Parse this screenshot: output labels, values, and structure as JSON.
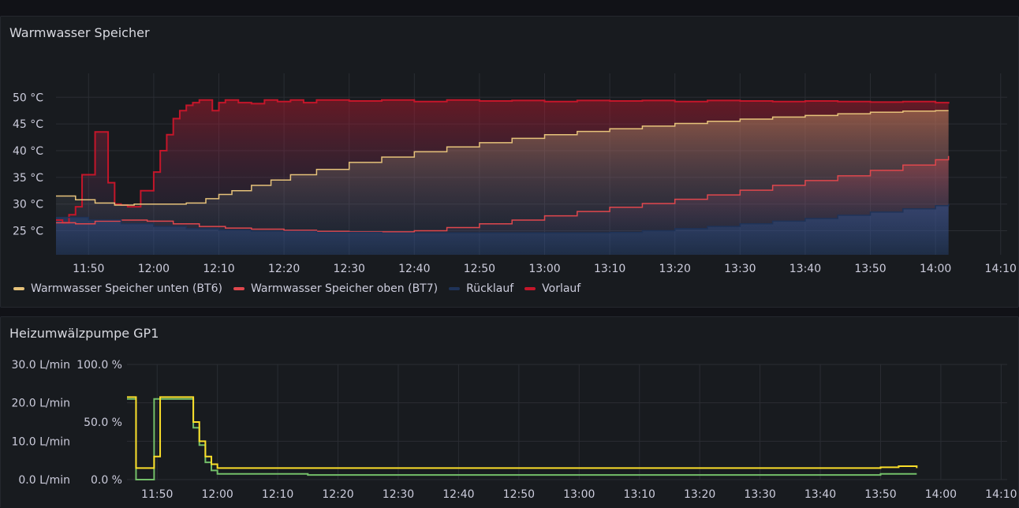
{
  "panels": {
    "speicher_title": "Warmwasser Speicher",
    "pumpe_title": "Heizumwälzpumpe GP1"
  },
  "colors": {
    "bt6": "#e6c27a",
    "bt7": "#e0474d",
    "ruecklauf": "#1f3358",
    "vorlauf": "#c4162a",
    "flow": "#fade2a",
    "percent": "#73bf69",
    "grid": "#2a2d33",
    "text": "#ccccdc"
  },
  "chart_data": [
    {
      "type": "line",
      "title": "Warmwasser Speicher",
      "x_ticks": [
        "11:50",
        "12:00",
        "12:10",
        "12:20",
        "12:30",
        "12:40",
        "12:50",
        "13:00",
        "13:10",
        "13:20",
        "13:30",
        "13:40",
        "13:50",
        "14:00",
        "14:10"
      ],
      "xlim": [
        "11:45",
        "14:11"
      ],
      "y_ticks": [
        "25 °C",
        "30 °C",
        "35 °C",
        "40 °C",
        "45 °C",
        "50 °C"
      ],
      "ylim": [
        20.5,
        53
      ],
      "x_unit": "minutes after 11:45 (sample times)",
      "legend_position": "bottom-left",
      "grid": true,
      "series": [
        {
          "name": "Warmwasser Speicher unten (BT6)",
          "color_key": "bt6",
          "points": [
            [
              0,
              31.5
            ],
            [
              3,
              30.8
            ],
            [
              6,
              30.2
            ],
            [
              9,
              29.8
            ],
            [
              12,
              30.0
            ],
            [
              15,
              30.0
            ],
            [
              20,
              30.2
            ],
            [
              23,
              31.0
            ],
            [
              25,
              31.8
            ],
            [
              27,
              32.5
            ],
            [
              30,
              33.5
            ],
            [
              33,
              34.5
            ],
            [
              36,
              35.5
            ],
            [
              40,
              36.5
            ],
            [
              45,
              37.8
            ],
            [
              50,
              38.8
            ],
            [
              55,
              39.8
            ],
            [
              60,
              40.7
            ],
            [
              65,
              41.5
            ],
            [
              70,
              42.3
            ],
            [
              75,
              43.0
            ],
            [
              80,
              43.6
            ],
            [
              85,
              44.1
            ],
            [
              90,
              44.6
            ],
            [
              95,
              45.1
            ],
            [
              100,
              45.5
            ],
            [
              105,
              45.9
            ],
            [
              110,
              46.3
            ],
            [
              115,
              46.6
            ],
            [
              120,
              46.9
            ],
            [
              125,
              47.2
            ],
            [
              130,
              47.4
            ],
            [
              135,
              47.5
            ],
            [
              137,
              47.5
            ]
          ]
        },
        {
          "name": "Warmwasser Speicher oben (BT7)",
          "color_key": "bt7",
          "points": [
            [
              0,
              26.5
            ],
            [
              3,
              26.3
            ],
            [
              6,
              26.8
            ],
            [
              10,
              27.0
            ],
            [
              14,
              26.8
            ],
            [
              18,
              26.3
            ],
            [
              22,
              25.8
            ],
            [
              26,
              25.5
            ],
            [
              30,
              25.3
            ],
            [
              35,
              25.1
            ],
            [
              40,
              24.9
            ],
            [
              45,
              24.8
            ],
            [
              50,
              24.8
            ],
            [
              55,
              25.0
            ],
            [
              60,
              25.6
            ],
            [
              65,
              26.3
            ],
            [
              70,
              27.0
            ],
            [
              75,
              27.8
            ],
            [
              80,
              28.6
            ],
            [
              85,
              29.4
            ],
            [
              90,
              30.1
            ],
            [
              95,
              30.9
            ],
            [
              100,
              31.7
            ],
            [
              105,
              32.6
            ],
            [
              110,
              33.5
            ],
            [
              115,
              34.4
            ],
            [
              120,
              35.3
            ],
            [
              125,
              36.3
            ],
            [
              130,
              37.3
            ],
            [
              135,
              38.3
            ],
            [
              137,
              39.0
            ]
          ]
        },
        {
          "name": "Rücklauf",
          "color_key": "ruecklauf",
          "points": [
            [
              0,
              27.5
            ],
            [
              5,
              27.0
            ],
            [
              10,
              26.3
            ],
            [
              15,
              25.8
            ],
            [
              20,
              25.4
            ],
            [
              25,
              25.1
            ],
            [
              30,
              24.9
            ],
            [
              40,
              24.7
            ],
            [
              50,
              24.6
            ],
            [
              60,
              24.6
            ],
            [
              70,
              24.6
            ],
            [
              80,
              24.6
            ],
            [
              85,
              24.7
            ],
            [
              90,
              25.0
            ],
            [
              95,
              25.4
            ],
            [
              100,
              25.8
            ],
            [
              105,
              26.3
            ],
            [
              110,
              26.8
            ],
            [
              115,
              27.3
            ],
            [
              120,
              27.9
            ],
            [
              125,
              28.5
            ],
            [
              130,
              29.1
            ],
            [
              135,
              29.7
            ],
            [
              137,
              30.0
            ]
          ]
        },
        {
          "name": "Vorlauf",
          "color_key": "vorlauf",
          "points": [
            [
              0,
              27.0
            ],
            [
              1,
              26.5
            ],
            [
              2,
              28.0
            ],
            [
              3,
              29.5
            ],
            [
              4,
              35.5
            ],
            [
              5,
              35.5
            ],
            [
              6,
              43.5
            ],
            [
              7,
              43.5
            ],
            [
              8,
              34.0
            ],
            [
              9,
              30.0
            ],
            [
              10,
              29.8
            ],
            [
              11,
              29.5
            ],
            [
              12,
              29.5
            ],
            [
              13,
              32.5
            ],
            [
              14,
              32.5
            ],
            [
              15,
              36.0
            ],
            [
              16,
              40.0
            ],
            [
              17,
              43.0
            ],
            [
              18,
              46.0
            ],
            [
              19,
              47.5
            ],
            [
              20,
              48.5
            ],
            [
              21,
              49.0
            ],
            [
              22,
              49.5
            ],
            [
              23,
              49.5
            ],
            [
              24,
              47.5
            ],
            [
              25,
              49.0
            ],
            [
              26,
              49.5
            ],
            [
              28,
              49.0
            ],
            [
              30,
              48.8
            ],
            [
              32,
              49.5
            ],
            [
              34,
              49.2
            ],
            [
              36,
              49.5
            ],
            [
              38,
              49.0
            ],
            [
              40,
              49.5
            ],
            [
              45,
              49.3
            ],
            [
              50,
              49.5
            ],
            [
              55,
              49.2
            ],
            [
              60,
              49.5
            ],
            [
              65,
              49.3
            ],
            [
              70,
              49.4
            ],
            [
              75,
              49.2
            ],
            [
              80,
              49.4
            ],
            [
              85,
              49.3
            ],
            [
              90,
              49.4
            ],
            [
              95,
              49.2
            ],
            [
              100,
              49.4
            ],
            [
              105,
              49.3
            ],
            [
              110,
              49.2
            ],
            [
              115,
              49.3
            ],
            [
              120,
              49.2
            ],
            [
              125,
              49.1
            ],
            [
              130,
              49.2
            ],
            [
              135,
              49.0
            ],
            [
              137,
              48.8
            ]
          ]
        }
      ]
    },
    {
      "type": "line",
      "title": "Heizumwälzpumpe GP1",
      "x_ticks": [
        "11:50",
        "12:00",
        "12:10",
        "12:20",
        "12:30",
        "12:40",
        "12:50",
        "13:00",
        "13:10",
        "13:20",
        "13:30",
        "13:40",
        "13:50",
        "14:00",
        "14:10"
      ],
      "xlim": [
        "11:45",
        "14:11"
      ],
      "x_unit": "minutes after 11:45 (sample times)",
      "y_left_ticks": [
        "0.0 L/min",
        "10.0 L/min",
        "20.0 L/min",
        "30.0 L/min"
      ],
      "y_left_lim": [
        0,
        30
      ],
      "y_right_ticks": [
        "0.0 %",
        "50.0 %",
        "100.0 %"
      ],
      "y_right_lim": [
        0,
        100
      ],
      "grid": true,
      "series": [
        {
          "axis": "left",
          "color_key": "flow",
          "unit": "L/min",
          "points": [
            [
              0,
              21.5
            ],
            [
              1,
              21.5
            ],
            [
              1.5,
              3.0
            ],
            [
              4,
              3.0
            ],
            [
              4.5,
              6.0
            ],
            [
              5,
              6.0
            ],
            [
              5.5,
              21.5
            ],
            [
              10,
              21.5
            ],
            [
              11,
              15.0
            ],
            [
              12,
              10.0
            ],
            [
              13,
              6.0
            ],
            [
              14,
              4.0
            ],
            [
              15,
              3.0
            ],
            [
              16,
              3.0
            ],
            [
              20,
              3.0
            ],
            [
              30,
              3.0
            ],
            [
              40,
              3.0
            ],
            [
              50,
              3.0
            ],
            [
              60,
              3.0
            ],
            [
              70,
              3.0
            ],
            [
              80,
              3.0
            ],
            [
              90,
              3.0
            ],
            [
              100,
              3.0
            ],
            [
              110,
              3.0
            ],
            [
              120,
              3.0
            ],
            [
              125,
              3.2
            ],
            [
              128,
              3.5
            ],
            [
              130,
              3.5
            ],
            [
              131,
              3.0
            ]
          ]
        },
        {
          "axis": "right",
          "color_key": "percent",
          "unit": "%",
          "points": [
            [
              0,
              70
            ],
            [
              1,
              70
            ],
            [
              1.5,
              0
            ],
            [
              4,
              0
            ],
            [
              4.5,
              70
            ],
            [
              10,
              70
            ],
            [
              11,
              45
            ],
            [
              12,
              30
            ],
            [
              13,
              15
            ],
            [
              14,
              8
            ],
            [
              15,
              5
            ],
            [
              20,
              5
            ],
            [
              30,
              4
            ],
            [
              40,
              4
            ],
            [
              50,
              4
            ],
            [
              60,
              4
            ],
            [
              70,
              4
            ],
            [
              80,
              4
            ],
            [
              90,
              4
            ],
            [
              100,
              4
            ],
            [
              110,
              4
            ],
            [
              120,
              4
            ],
            [
              125,
              5
            ],
            [
              128,
              5
            ],
            [
              130,
              5
            ],
            [
              131,
              5
            ]
          ]
        }
      ]
    }
  ]
}
